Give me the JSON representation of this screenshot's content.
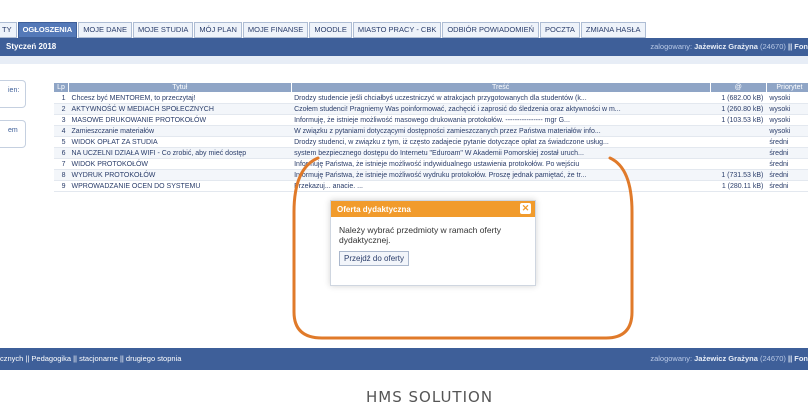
{
  "tabs": [
    "TY",
    "OGŁOSZENIA",
    "MOJE DANE",
    "MOJE STUDIA",
    "MÓJ PLAN",
    "MOJE FINANSE",
    "MOODLE",
    "MIASTO PRACY - CBK",
    "ODBIÓR POWIADOMIEŃ",
    "POCZTA",
    "ZMIANA HASŁA"
  ],
  "header": {
    "date": "Styczeń 2018",
    "logged_label": "zalogowany:",
    "user": "Jażewicz Grażyna",
    "user_id": "(24670)",
    "extra": "|| Fon"
  },
  "sidebar": [
    "ien:",
    "em"
  ],
  "table": {
    "columns": [
      "Lp",
      "Tytuł",
      "Treść",
      "@",
      "Priorytet"
    ],
    "rows": [
      {
        "lp": "1",
        "title": "Chcesz być MENTOREM, to przeczytaj!",
        "content": "Drodzy studencie jeśli chciałbyś uczestniczyć w atrakcjach przygotowanych dla studentów (k...",
        "att": "1 (682.00 kB)",
        "prio": "wysoki"
      },
      {
        "lp": "2",
        "title": "AKTYWNOŚĆ W MEDIACH SPOŁECZNYCH",
        "content": "Czołem studenci! Pragniemy Was poinformować, zachęcić i zaprosić do śledzenia oraz aktywności w m...",
        "att": "1 (260.80 kB)",
        "prio": "wysoki"
      },
      {
        "lp": "3",
        "title": "MASOWE DRUKOWANIE PROTOKOŁÓW",
        "content": "Informuję, że istnieje możliwość masowego drukowania protokołów. ---------------- mgr G...",
        "att": "1 (103.53 kB)",
        "prio": "wysoki"
      },
      {
        "lp": "4",
        "title": "Zamieszczanie materiałów",
        "content": "W związku z pytaniami dotyczącymi dostępności zamieszczanych przez Państwa materiałów info...",
        "att": "",
        "prio": "wysoki"
      },
      {
        "lp": "5",
        "title": "WIDOK OPŁAT ZA STUDIA",
        "content": "Drodzy studenci, w związku z tym, iż często zadajecie pytanie dotyczące opłat za świadczone usług...",
        "att": "",
        "prio": "średni"
      },
      {
        "lp": "6",
        "title": "NA UCZELNI DZIAŁA WIFI - Co zrobić, aby mieć dostęp",
        "content": "system bezpiecznego dostępu do Internetu \"Eduroam\" W Akademii Pomorskiej został uruch...",
        "att": "",
        "prio": "średni"
      },
      {
        "lp": "7",
        "title": "WIDOK PROTOKOŁÓW",
        "content": "Informuję Państwa, że istnieje możliwość indywidualnego ustawienia protokołów. Po wejściu",
        "att": "",
        "prio": "średni"
      },
      {
        "lp": "8",
        "title": "WYDRUK PROTOKOŁÓW",
        "content": "Informuję Państwa, że istnieje możliwość wydruku protokołów. Proszę jednak pamiętać, że tr...",
        "att": "1 (731.53 kB)",
        "prio": "średni"
      },
      {
        "lp": "9",
        "title": "WPROWADZANIE OCEN DO SYSTEMU",
        "content": "Przekazuj...                                                   anacie.  ...",
        "att": "1 (280.11 kB)",
        "prio": "średni"
      }
    ]
  },
  "modal": {
    "title": "Oferta dydaktyczna",
    "message": "Należy wybrać przedmioty w ramach oferty dydaktycznej.",
    "button": "Przejdź do oferty"
  },
  "footer": {
    "path": "cznych || Pedagogika || stacjonarne || drugiego stopnia",
    "logged_label": "zalogowany:",
    "user": "Jażewicz Grażyna",
    "user_id": "(24670)",
    "extra": "|| Fon"
  },
  "brand": "HMS SOLUTION",
  "colors": {
    "accent": "#3e5f99",
    "modal_header": "#f19b2c",
    "annotation": "#e07a2a"
  }
}
